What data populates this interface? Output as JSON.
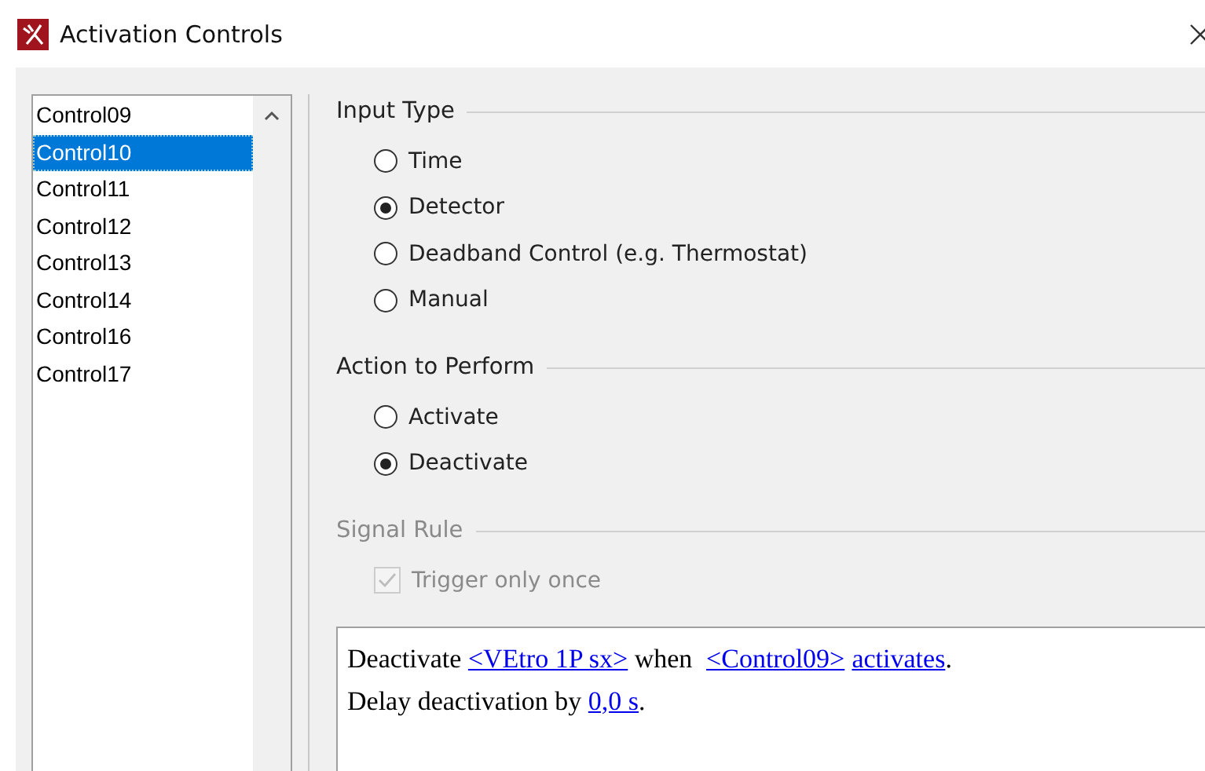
{
  "window": {
    "title": "Activation Controls"
  },
  "control_list": {
    "items": [
      {
        "label": "Control09",
        "selected": false
      },
      {
        "label": "Control10",
        "selected": true
      },
      {
        "label": "Control11",
        "selected": false
      },
      {
        "label": "Control12",
        "selected": false
      },
      {
        "label": "Control13",
        "selected": false
      },
      {
        "label": "Control14",
        "selected": false
      },
      {
        "label": "Control16",
        "selected": false
      },
      {
        "label": "Control17",
        "selected": false
      }
    ]
  },
  "groups": [
    {
      "title": "Input Type",
      "disabled": false,
      "options": [
        {
          "kind": "radio",
          "label": "Time",
          "selected": false
        },
        {
          "kind": "radio",
          "label": "Detector",
          "selected": true
        },
        {
          "kind": "radio",
          "label": "Deadband Control (e.g. Thermostat)",
          "selected": false
        },
        {
          "kind": "radio",
          "label": "Manual",
          "selected": false
        }
      ]
    },
    {
      "title": "Action to Perform",
      "disabled": false,
      "options": [
        {
          "kind": "radio",
          "label": "Activate",
          "selected": false
        },
        {
          "kind": "radio",
          "label": "Deactivate",
          "selected": true
        }
      ]
    },
    {
      "title": "Signal Rule",
      "disabled": true,
      "options": [
        {
          "kind": "checkbox",
          "label": "Trigger only once",
          "checked": true
        }
      ]
    }
  ],
  "rule_text": {
    "lines": [
      [
        {
          "kind": "text",
          "text": "Deactivate "
        },
        {
          "kind": "link",
          "text": "<VEtro 1P sx>"
        },
        {
          "kind": "text",
          "text": " when "
        },
        {
          "kind": "link",
          "text": "<Control09>"
        },
        {
          "kind": "link",
          "text": "activates"
        },
        {
          "kind": "text",
          "text": "."
        }
      ],
      [
        {
          "kind": "text",
          "text": "Delay deactivation by "
        },
        {
          "kind": "link",
          "text": "0,0 s"
        },
        {
          "kind": "text",
          "text": "."
        }
      ]
    ]
  }
}
